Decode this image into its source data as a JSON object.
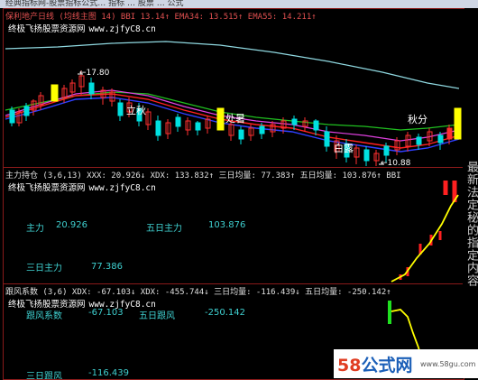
{
  "titlebar": {
    "text": "经典指标网-股票指标公式… 指标 … 股票 … 公式"
  },
  "main_panel": {
    "header": "保利地产日线 (均线主图 14)  BBI 13.14↑  EMA34: 13.515↑  EMA55: 14.211↑",
    "watermark": "终极飞扬股票资源网",
    "watermark_url": "www.zjfyC8.cn",
    "annotations": {
      "high_price": "←17.80",
      "low_price": "←10.88",
      "label_liqiu": "立秋",
      "label_chushu": "处暑",
      "label_bailu": "白露",
      "label_qiufen": "秋分"
    },
    "colors": {
      "candle_up": "#ff3030",
      "candle_down": "#00e0e0",
      "accent_yellow": "#ffff00",
      "ma_green": "#20c020",
      "ma_magenta": "#e040e0",
      "ma_red": "#ff2020",
      "ma_blue": "#3040ff",
      "ma_cyan": "#8fd8e0"
    }
  },
  "panel2": {
    "header": "主力持仓 (3,6,13)  XXX: 20.926↓  XDX: 133.832↑  三日均量: 77.383↑  五日均量: 103.876↑  BBI",
    "watermark": "终极飞扬股票资源网",
    "watermark_url": "www.zjfyC8.cn",
    "labels": {
      "zhuli_name": "主力",
      "zhuli_value": "20.926",
      "wuri_zhuli_name": "五日主力",
      "wuri_zhuli_value": "103.876",
      "sanri_zhuli_name": "三日主力",
      "sanri_zhuli_value": "77.386"
    }
  },
  "panel3": {
    "header": "跟风系数 (3,6)  XDX: -67.103↓  XDX: -455.744↓  三日均量: -116.439↓  五日均量: -250.142↑",
    "watermark": "终极飞扬股票资源网",
    "watermark_url": "www.zjfyC8.cn",
    "labels": {
      "genfeng_name": "跟风系数",
      "genfeng_value": "-67.103",
      "wuri_genfeng_name": "五日跟风",
      "wuri_genfeng_value": "-250.142",
      "sanri_genfeng_name": "三日跟风",
      "sanri_genfeng_value": "-116.439"
    }
  },
  "right_sidebar": {
    "text": "最新法定秘的指定内容"
  },
  "footer": {
    "logo_num": "58",
    "logo_cn": "公式网",
    "url": "www.58gu.com"
  }
}
